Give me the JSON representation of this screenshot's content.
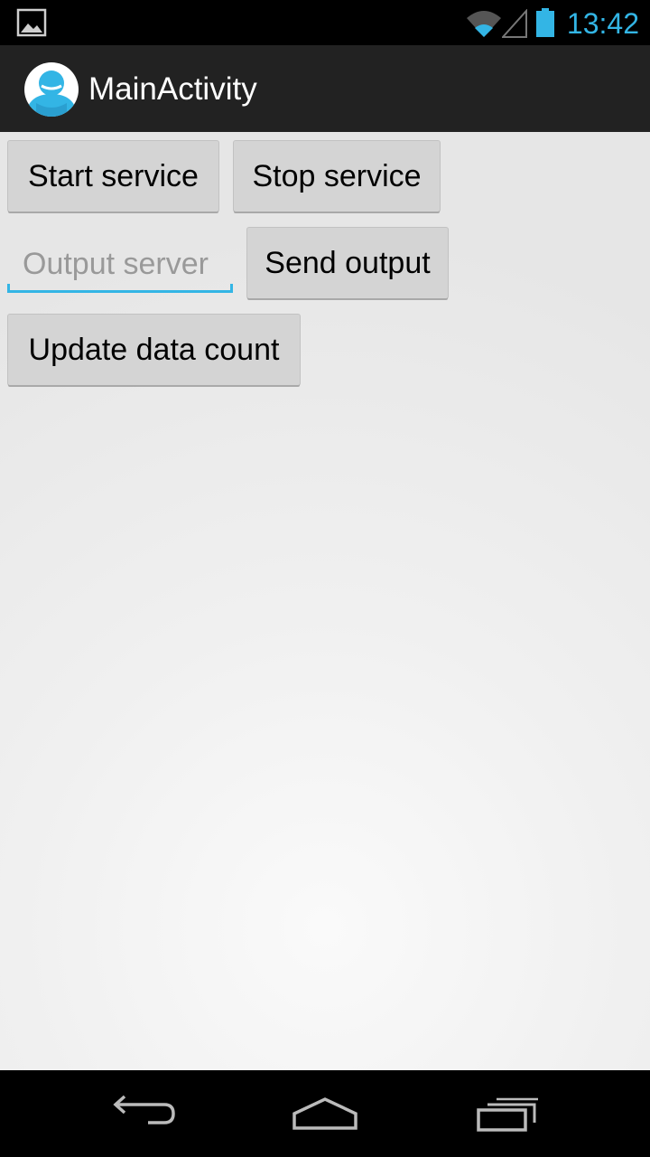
{
  "status_bar": {
    "time": "13:42",
    "accent_color": "#33b5e5",
    "icons": [
      "image-notification-icon",
      "wifi-icon",
      "signal-icon",
      "battery-icon"
    ]
  },
  "action_bar": {
    "title": "MainActivity",
    "icon": "app-avatar-icon"
  },
  "content": {
    "start_service_label": "Start service",
    "stop_service_label": "Stop service",
    "output_server_placeholder": "Output server",
    "output_server_value": "",
    "send_output_label": "Send output",
    "update_data_count_label": "Update data count"
  },
  "nav_bar": {
    "icons": [
      "back-icon",
      "home-icon",
      "recents-icon"
    ]
  }
}
